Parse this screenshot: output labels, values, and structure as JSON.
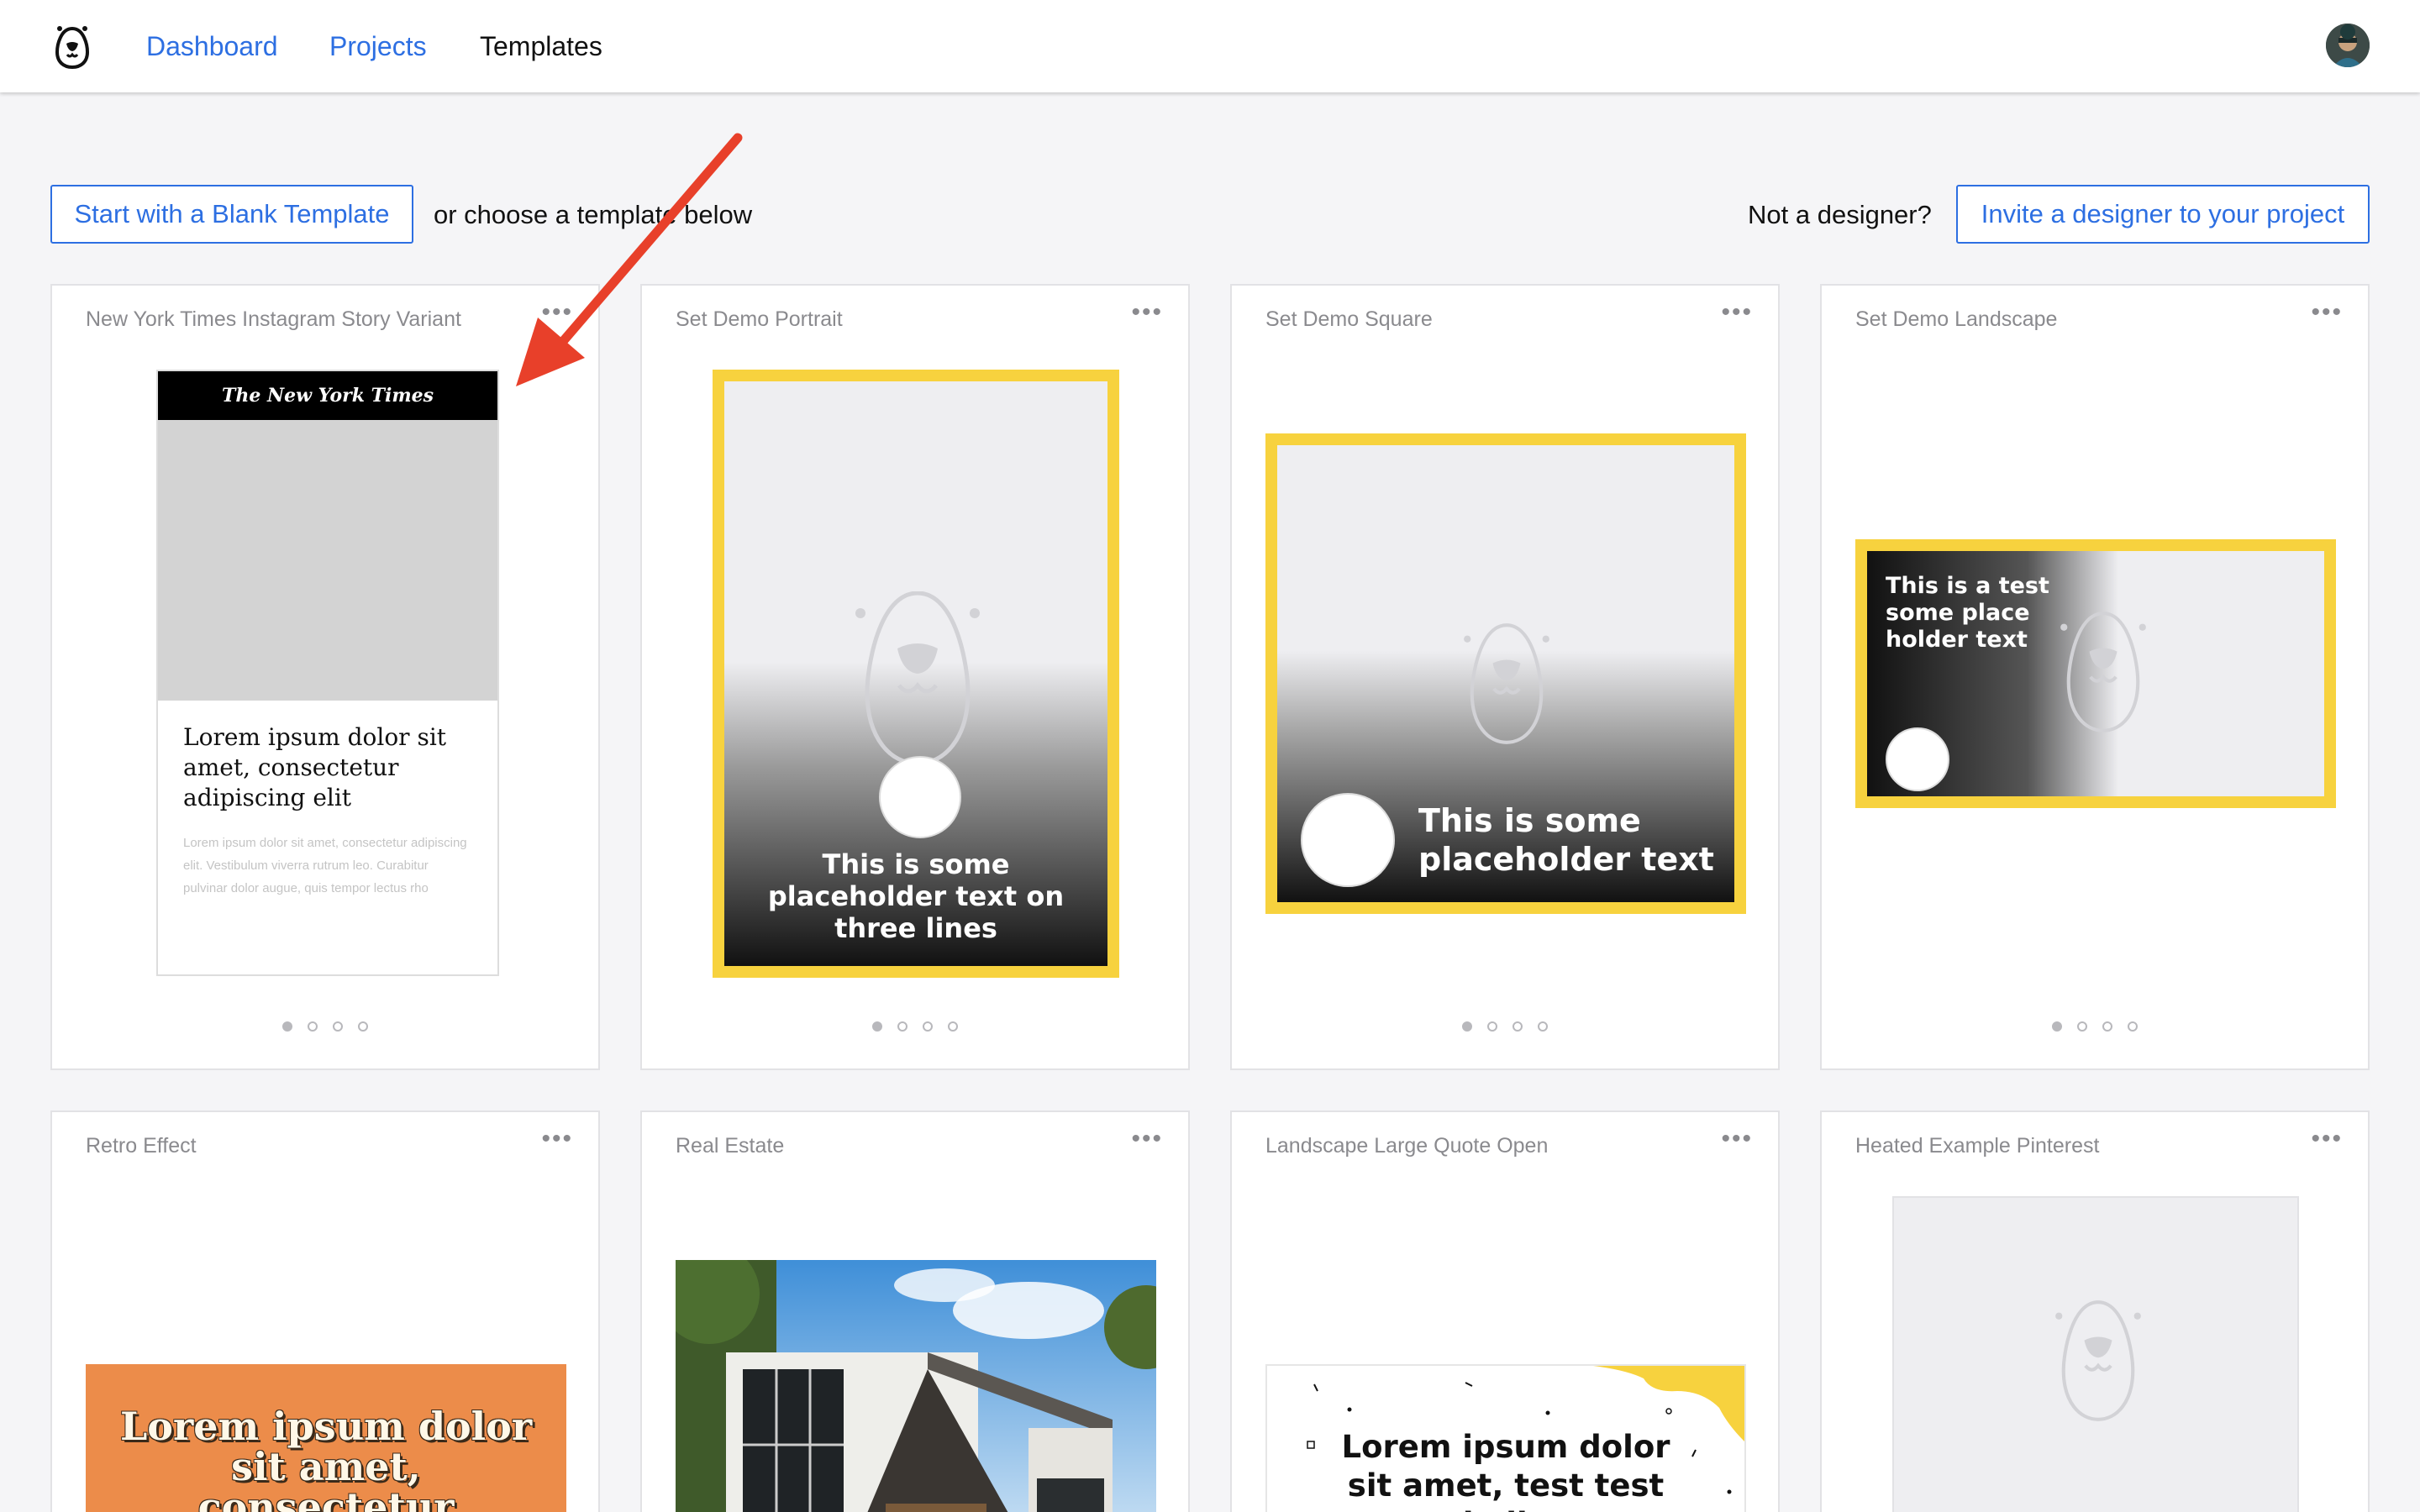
{
  "header": {
    "nav": [
      {
        "label": "Dashboard"
      },
      {
        "label": "Projects"
      },
      {
        "label": "Templates"
      }
    ]
  },
  "toolbar": {
    "blank_template_label": "Start with a Blank Template",
    "choose_text": "or choose a template below",
    "not_designer_text": "Not a designer?",
    "invite_label": "Invite a designer to your project"
  },
  "templates": [
    {
      "title": "New York Times Instagram Story Variant",
      "logo_text": "The New York Times",
      "headline": "Lorem ipsum dolor sit amet, consectetur adipiscing elit",
      "body": "Lorem ipsum dolor sit amet, consectetur adipiscing elit. Vestibulum viverra rutrum leo. Curabitur pulvinar dolor augue, quis tempor lectus rho"
    },
    {
      "title": "Set Demo Portrait",
      "text": "This is some placeholder text on three lines"
    },
    {
      "title": "Set Demo Square",
      "text": "This is some placeholder text"
    },
    {
      "title": "Set Demo Landscape",
      "text": "This is a test some place holder text"
    },
    {
      "title": "Retro Effect",
      "text": "Lorem ipsum dolor sit amet, consectetur"
    },
    {
      "title": "Real Estate"
    },
    {
      "title": "Landscape Large Quote Open",
      "text": "Lorem ipsum dolor sit amet, test test hello"
    },
    {
      "title": "Heated Example Pinterest"
    }
  ],
  "menu_glyph": "•••",
  "colors": {
    "accent": "#2d6fe2",
    "frame_yellow": "#f7d23e",
    "retro_orange": "#ec8c4a",
    "arrow_red": "#e8402a"
  }
}
